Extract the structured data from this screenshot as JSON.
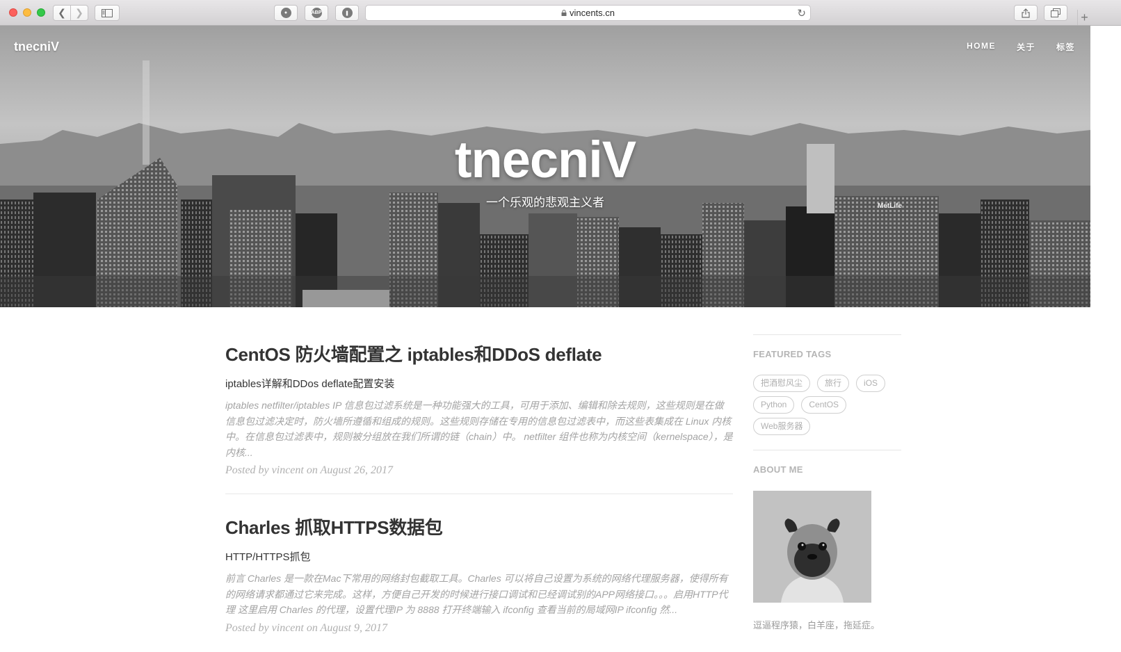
{
  "browser": {
    "url": "vincents.cn",
    "extensions": [
      "ghostery-icon",
      "adblock-plus-icon",
      "1password-icon"
    ]
  },
  "site": {
    "brand": "tnecniV",
    "nav": [
      {
        "label": "HOME"
      },
      {
        "label": "关于"
      },
      {
        "label": "标签"
      }
    ],
    "hero_title": "tnecniV",
    "hero_subtitle": "一个乐观的悲观主义者"
  },
  "posts": [
    {
      "title": "CentOS 防火墙配置之 iptables和DDoS deflate",
      "subtitle": "iptables详解和DDos deflate配置安装",
      "excerpt": "iptables netfilter/iptables IP 信息包过滤系统是一种功能强大的工具，可用于添加、编辑和除去规则，这些规则是在做信息包过滤决定时，防火墙所遵循和组成的规则。这些规则存储在专用的信息包过滤表中，而这些表集成在 Linux 内核中。在信息包过滤表中，规则被分组放在我们所谓的链（chain）中。 netfilter 组件也称为内核空间（kernelspace），是内核...",
      "meta": "Posted by vincent on August 26, 2017"
    },
    {
      "title": "Charles 抓取HTTPS数据包",
      "subtitle": "HTTP/HTTPS抓包",
      "excerpt": "前言 Charles 是一款在Mac下常用的网络封包截取工具。Charles 可以将自己设置为系统的网络代理服务器，使得所有的网络请求都通过它来完成。这样，方便自己开发的时候进行接口调试和已经调试别的APP网络接口。。。启用HTTP代理 这里启用 Charles 的代理，设置代理IP 为 8888 打开终端输入 ifconfig 查看当前的局域网IP ifconfig 然...",
      "meta": "Posted by vincent on August 9, 2017"
    }
  ],
  "sidebar": {
    "featured_tags_heading": "FEATURED TAGS",
    "tags": [
      "把酒慰风尘",
      "旅行",
      "iOS",
      "Python",
      "CentOS",
      "Web服务器"
    ],
    "about_heading": "ABOUT ME",
    "about_text": "逗逼程序猿，白羊座，拖延症。"
  }
}
